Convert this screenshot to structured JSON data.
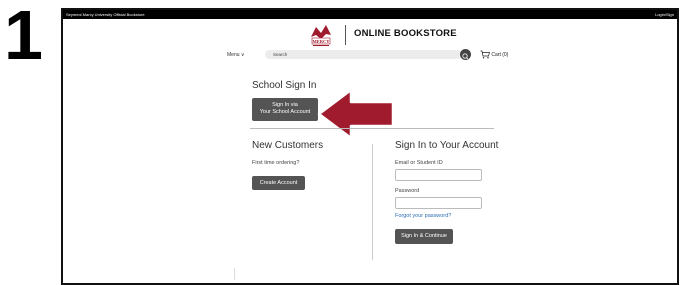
{
  "step": "1",
  "topbar": {
    "left_text": "Seymeol Marcy University Official Bookstore",
    "right_text": "Login/Sign"
  },
  "header": {
    "title": "ONLINE BOOKSTORE",
    "logo_text": "MERCY"
  },
  "nav": {
    "menu_label": "Menu ∨",
    "search_placeholder": "Search",
    "cart_label": "Cart (0)"
  },
  "school": {
    "title": "School Sign In",
    "button_line1": "Sign In via",
    "button_line2": "Your School Account"
  },
  "new_customers": {
    "title": "New Customers",
    "text": "First time ordering?",
    "button": "Create Account"
  },
  "sign_in": {
    "title": "Sign In to Your Account",
    "email_label": "Email or Student ID",
    "password_label": "Password",
    "forgot_link": "Forgot your password?",
    "button": "Sign In & Continue"
  },
  "colors": {
    "accent_arrow": "#a01b2e",
    "button_bg": "#545454",
    "link": "#2a6fb5"
  },
  "icons": [
    "mercy-logo-icon",
    "search-icon",
    "cart-icon",
    "arrow-pointer-icon"
  ]
}
